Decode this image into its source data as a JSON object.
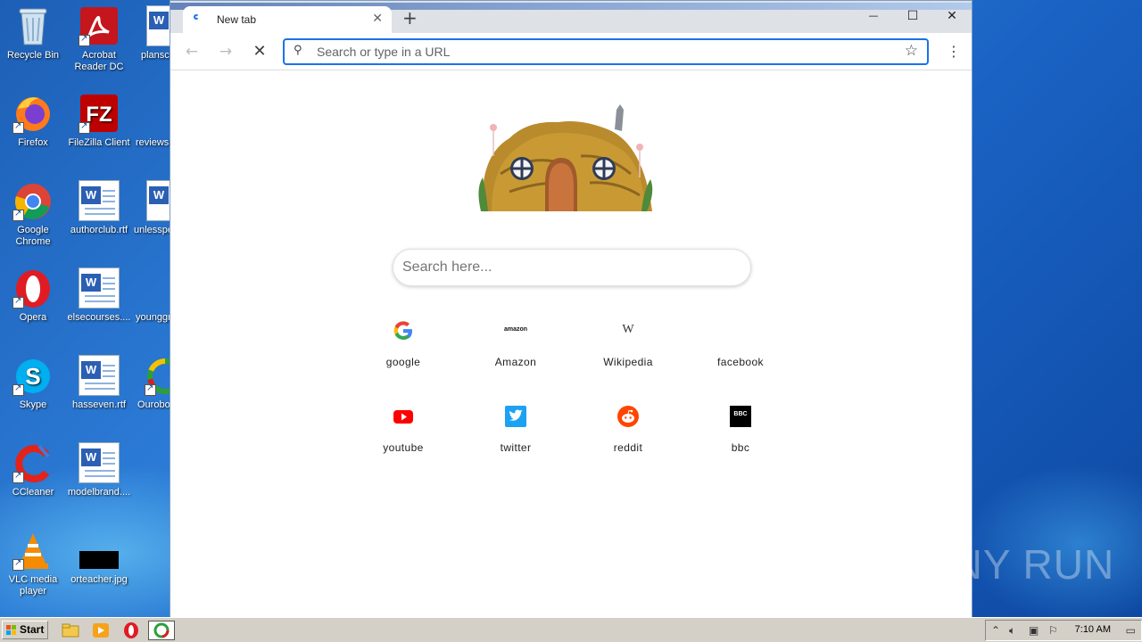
{
  "desktop": {
    "icons": [
      {
        "label": "Recycle Bin",
        "icon": "recycle-bin-icon"
      },
      {
        "label": "Acrobat Reader DC",
        "icon": "acrobat-icon"
      },
      {
        "label": "planscu",
        "icon": "word-doc-icon"
      },
      {
        "label": "Firefox",
        "icon": "firefox-icon"
      },
      {
        "label": "FileZilla Client",
        "icon": "filezilla-icon"
      },
      {
        "label": "reviews",
        "icon": "file-icon"
      },
      {
        "label": "Google Chrome",
        "icon": "chrome-icon"
      },
      {
        "label": "authorclub.rtf",
        "icon": "word-doc-icon"
      },
      {
        "label": "unlesspe",
        "icon": "word-doc-icon"
      },
      {
        "label": "Opera",
        "icon": "opera-icon"
      },
      {
        "label": "elsecourses....",
        "icon": "word-doc-icon"
      },
      {
        "label": "younggr",
        "icon": "file-icon"
      },
      {
        "label": "Skype",
        "icon": "skype-icon"
      },
      {
        "label": "hasseven.rtf",
        "icon": "word-doc-icon"
      },
      {
        "label": "Ourobo",
        "icon": "ouroboros-icon"
      },
      {
        "label": "CCleaner",
        "icon": "ccleaner-icon"
      },
      {
        "label": "modelbrand....",
        "icon": "word-doc-icon"
      },
      {
        "label": "VLC media player",
        "icon": "vlc-icon"
      },
      {
        "label": "orteacher.jpg",
        "icon": "image-file-icon"
      }
    ]
  },
  "browser": {
    "tab_title": "New tab",
    "new_tab_symbol": "+",
    "tab_close_symbol": "✕",
    "omnibox_placeholder": "Search or type in a URL",
    "window_controls": {
      "minimize": "—",
      "maximize": "☐",
      "close": "✕"
    }
  },
  "page": {
    "search_placeholder": "Search here...",
    "tiles": [
      {
        "label": "google",
        "icon": "google-icon"
      },
      {
        "label": "Amazon",
        "icon": "amazon-icon",
        "logo_text": "amazon"
      },
      {
        "label": "Wikipedia",
        "icon": "wikipedia-icon",
        "logo_text": "W"
      },
      {
        "label": "facebook",
        "icon": "facebook-icon"
      },
      {
        "label": "youtube",
        "icon": "youtube-icon"
      },
      {
        "label": "twitter",
        "icon": "twitter-icon"
      },
      {
        "label": "reddit",
        "icon": "reddit-icon"
      },
      {
        "label": "bbc",
        "icon": "bbc-icon",
        "logo_text": "BBC"
      }
    ]
  },
  "taskbar": {
    "start_label": "Start",
    "clock": "7:10 AM"
  },
  "watermark": "ANY RUN",
  "colors": {
    "desktop": "#1d5fb6",
    "omnibox_border": "#1a73e8",
    "youtube": "#ff0000",
    "twitter": "#1da1f2",
    "reddit": "#ff4500",
    "bbc": "#000000"
  }
}
